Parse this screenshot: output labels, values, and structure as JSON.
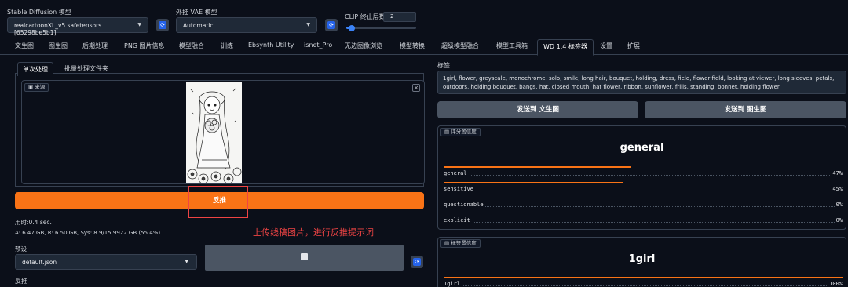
{
  "top": {
    "model_label": "Stable Diffusion 模型",
    "model_value": "realcartoonXL_v5.safetensors [65298be5b1]",
    "vae_label": "外挂 VAE 模型",
    "vae_value": "Automatic",
    "clip_label": "CLIP 终止层数",
    "clip_value": "2",
    "clip_fraction": 0.08
  },
  "tabs": [
    "文生图",
    "图生图",
    "后期处理",
    "PNG 图片信息",
    "模型融合",
    "训练",
    "Ebsynth Utility",
    "isnet_Pro",
    "无边图像浏览",
    "模型转换",
    "超级模型融合",
    "模型工具箱",
    "WD 1.4 标签器",
    "设置",
    "扩展"
  ],
  "left": {
    "subtabs": [
      "单次处理",
      "批量处理文件夹"
    ],
    "source_label": "来源",
    "close_glyph": "×",
    "interrogate_button": "反推",
    "time_text": "用时:0.4 sec.",
    "memory_text": "A: 6.47 GB, R: 6.50 GB, Sys: 8.9/15.9922 GB (55.4%)",
    "preset_label": "预设",
    "preset_value": "default.json",
    "interrogate_label": "反推",
    "annotation": "上传线稿图片，进行反推提示词"
  },
  "right": {
    "tags_label": "标签",
    "tags_text": "1girl, flower, greyscale, monochrome, solo, smile, long hair, bouquet, holding, dress, field, flower field, looking at viewer, long sleeves, petals, outdoors, holding bouquet, bangs, hat, closed mouth, hat flower, ribbon, sunflower, frills, standing, bonnet, holding flower",
    "send_txt2img": "发送到 文生图",
    "send_img2img": "发送到 图生图",
    "rating_panel_label": "评分置信度",
    "rating_top": "general",
    "ratings": [
      {
        "name": "general",
        "value": "47%",
        "fraction": 0.47
      },
      {
        "name": "sensitive",
        "value": "45%",
        "fraction": 0.45
      },
      {
        "name": "questionable",
        "value": "0%",
        "fraction": 0.0
      },
      {
        "name": "explicit",
        "value": "0%",
        "fraction": 0.0
      }
    ],
    "tag_panel_label": "标签置信度",
    "tag_top": "1girl",
    "tag_rows": [
      {
        "name": "1girl",
        "value": "100%",
        "fraction": 1.0
      }
    ]
  },
  "colors": {
    "accent": "#f97316",
    "background": "#0b0f19",
    "annotation": "#ef4444"
  }
}
